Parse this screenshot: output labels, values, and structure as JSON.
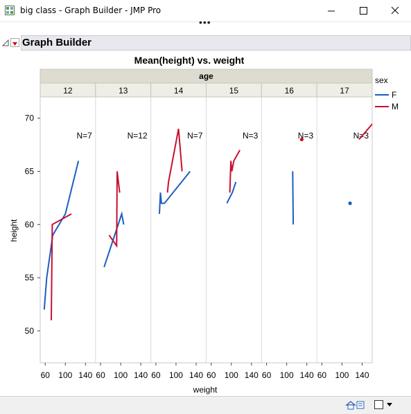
{
  "window": {
    "title": "big class - Graph Builder - JMP Pro"
  },
  "panel": {
    "title": "Graph Builder"
  },
  "chart_data": {
    "type": "line",
    "title": "Mean(height) vs. weight",
    "facet_label": "age",
    "facets": [
      "12",
      "13",
      "14",
      "15",
      "16",
      "17"
    ],
    "xlabel": "weight",
    "ylabel": "height",
    "xlim": [
      50,
      160
    ],
    "ylim": [
      47,
      72
    ],
    "x_ticks": [
      "60",
      "100",
      "140"
    ],
    "y_ticks": [
      50,
      55,
      60,
      65,
      70
    ],
    "legend": {
      "title": "sex",
      "position": "right",
      "entries": [
        {
          "name": "F",
          "color": "#1a5fbf"
        },
        {
          "name": "M",
          "color": "#c8102e"
        }
      ]
    },
    "series": [
      {
        "name": "F",
        "color": "#1a5fbf",
        "panels": [
          [
            [
              58,
              52
            ],
            [
              63,
              55
            ],
            [
              75,
              59
            ],
            [
              100,
              61
            ],
            [
              126,
              66
            ]
          ],
          [
            [
              67,
              56
            ],
            [
              102,
              61
            ],
            [
              106,
              60
            ]
          ],
          [
            [
              67,
              61
            ],
            [
              69,
              63
            ],
            [
              71,
              62
            ],
            [
              77,
              62
            ],
            [
              128,
              65
            ]
          ],
          [
            [
              91,
              62
            ],
            [
              102,
              63
            ],
            [
              109,
              64
            ]
          ],
          [
            [
              112,
              65
            ],
            [
              113,
              60
            ]
          ],
          [
            [
              116,
              62
            ]
          ]
        ]
      },
      {
        "name": "M",
        "color": "#c8102e",
        "panels": [
          [
            [
              72,
              51
            ],
            [
              74,
              60
            ],
            [
              112,
              61
            ]
          ],
          [
            [
              77,
              59
            ],
            [
              92,
              58
            ],
            [
              93,
              65
            ],
            [
              98,
              63
            ]
          ],
          [
            [
              83,
              63
            ],
            [
              85,
              64
            ],
            [
              97,
              67
            ],
            [
              105,
              69
            ],
            [
              112,
              65
            ]
          ],
          [
            [
              97,
              63
            ],
            [
              99,
              66
            ],
            [
              101,
              65
            ],
            [
              105,
              66
            ],
            [
              117,
              67
            ]
          ],
          [
            [
              130,
              68
            ]
          ],
          [
            [
              134,
              68
            ],
            [
              170,
              70
            ]
          ]
        ]
      }
    ],
    "annotations": [
      "N=7",
      "N=12",
      "N=7",
      "N=3",
      "N=3",
      "N=3"
    ]
  }
}
